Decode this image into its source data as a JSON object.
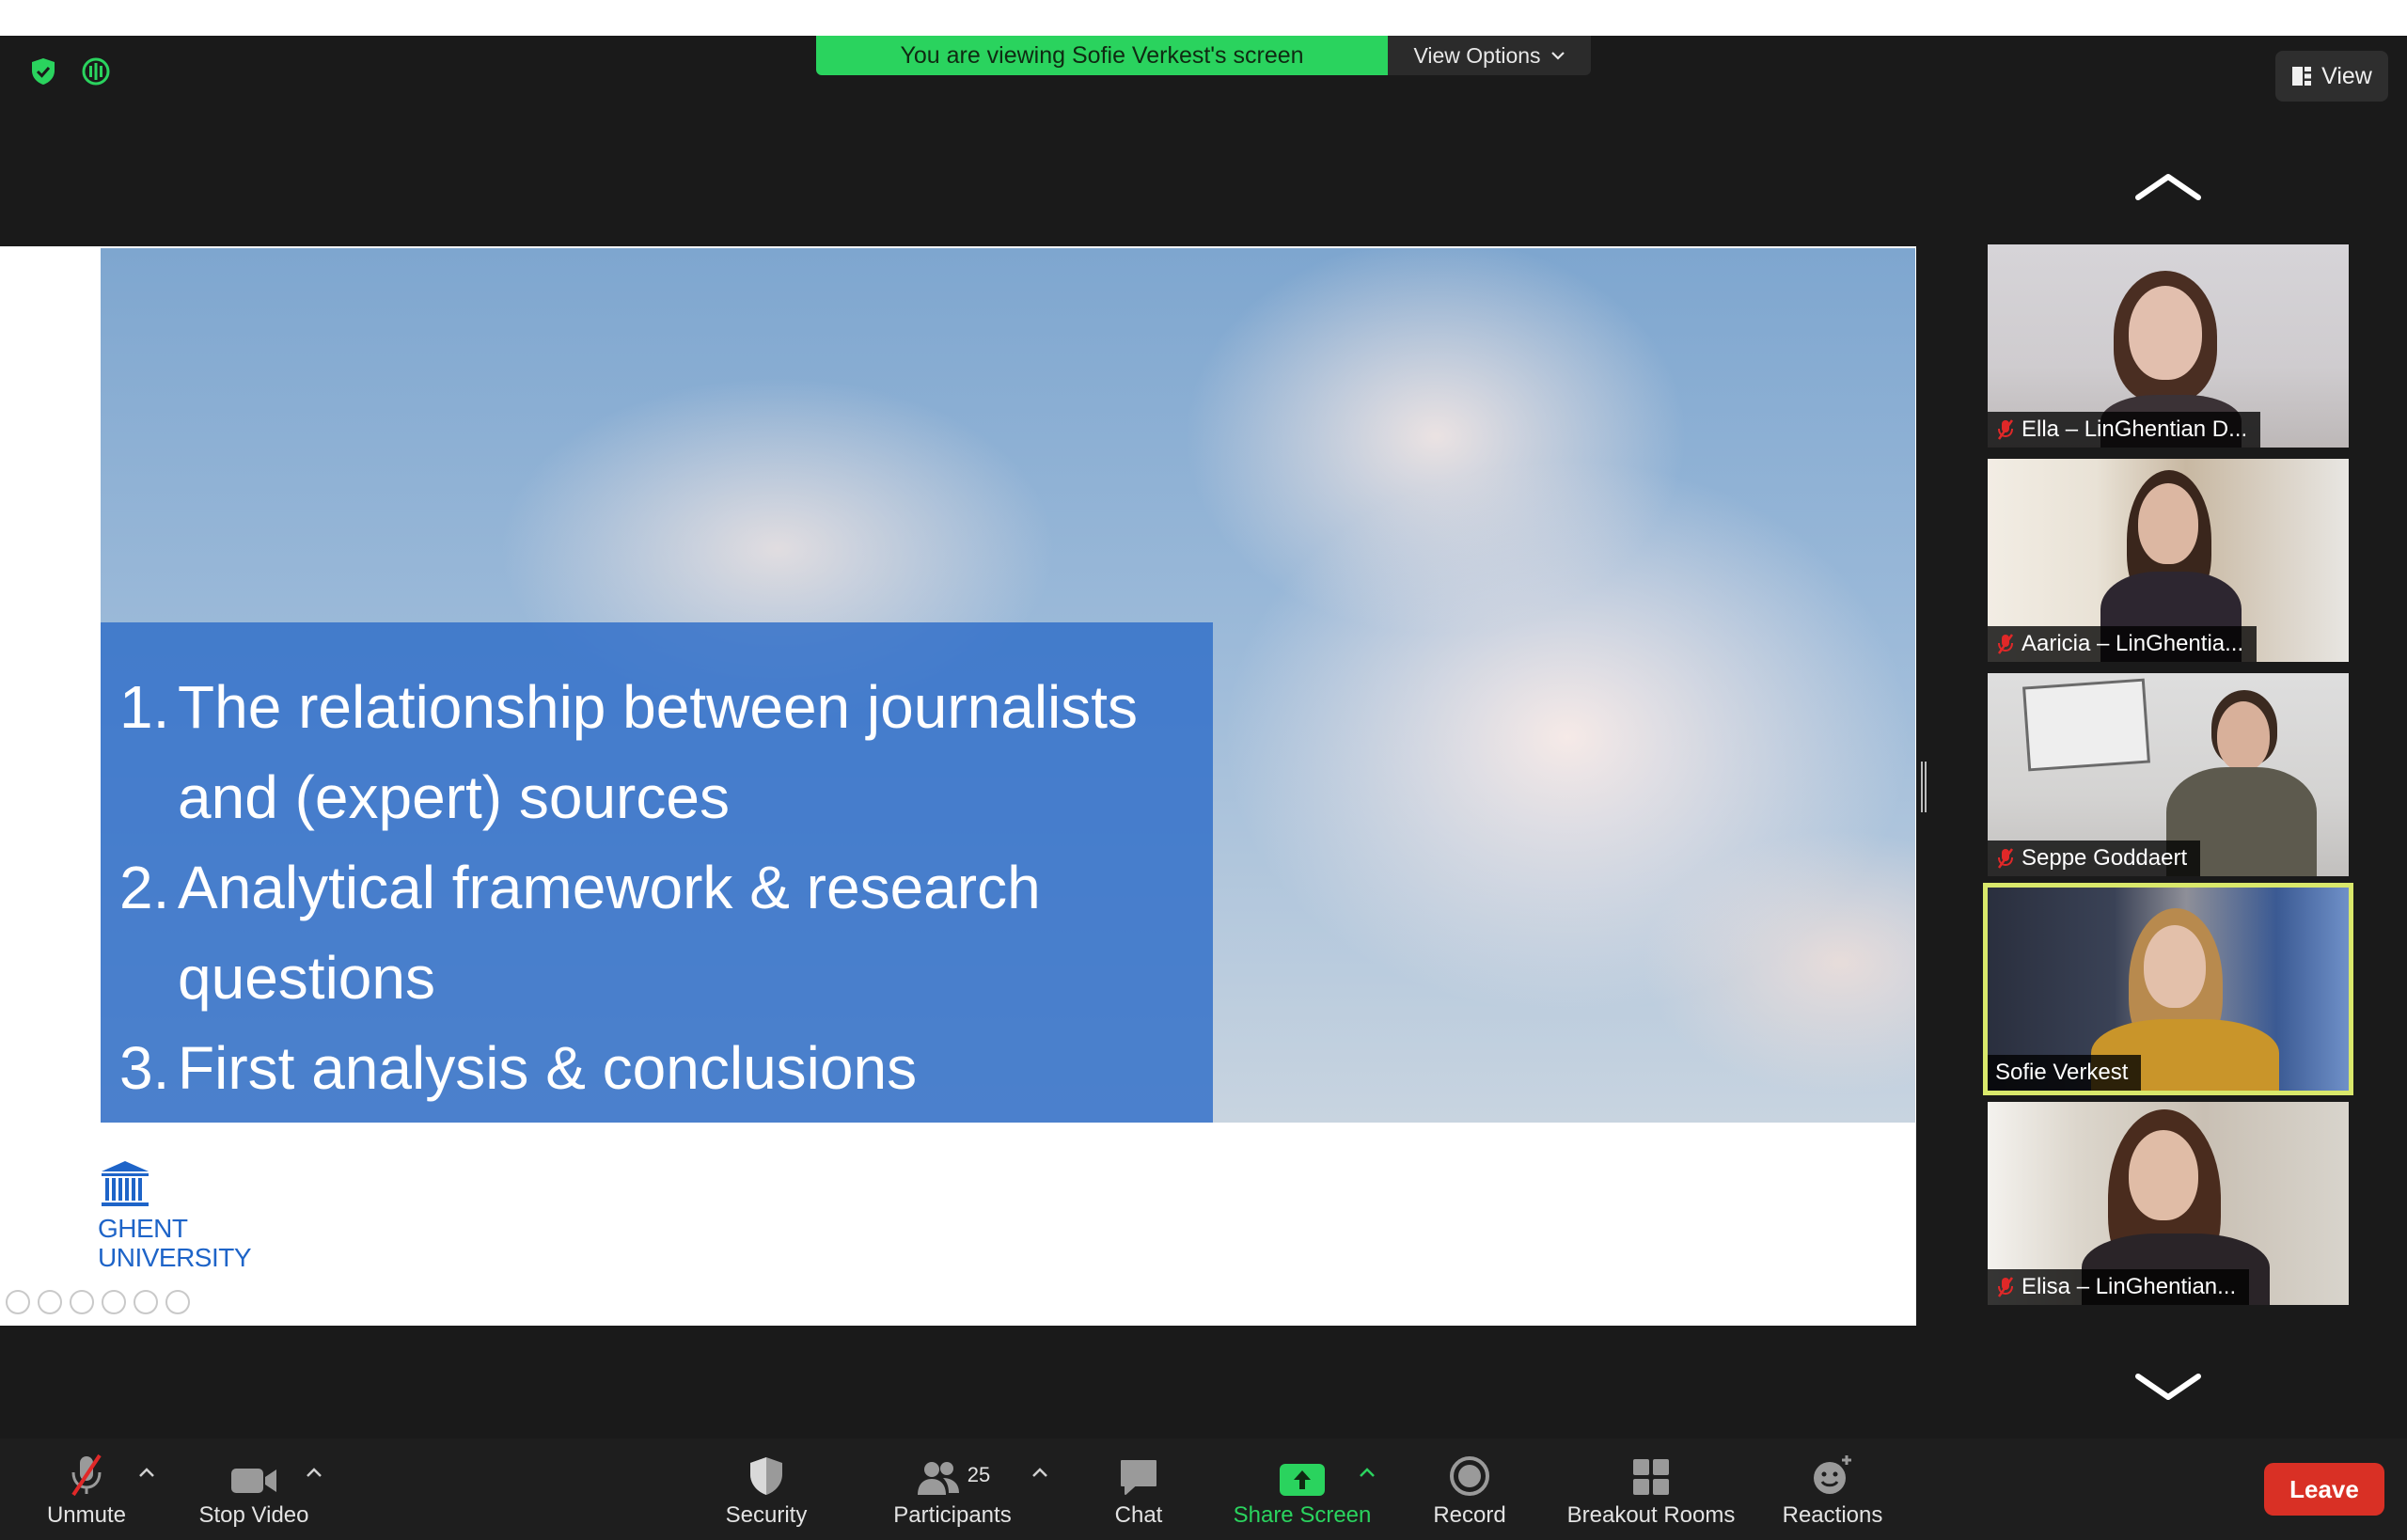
{
  "banner": {
    "message": "You are viewing Sofie Verkest's screen",
    "options_label": "View Options"
  },
  "view_button": {
    "label": "View"
  },
  "status_icons": [
    "shield-check-icon",
    "recording-indicator-icon"
  ],
  "slide": {
    "items": [
      {
        "num": "1.",
        "text": "The relationship between journalists and (expert) sources"
      },
      {
        "num": "2.",
        "text": "Analytical framework & research questions"
      },
      {
        "num": "3.",
        "text": "First analysis & conclusions"
      }
    ],
    "logo": {
      "line1": "GHENT",
      "line2": "UNIVERSITY"
    }
  },
  "gallery": [
    {
      "name": "Ella – LinGhentian D...",
      "muted": true,
      "active": false
    },
    {
      "name": "Aaricia – LinGhentia...",
      "muted": true,
      "active": false
    },
    {
      "name": "Seppe Goddaert",
      "muted": true,
      "active": false
    },
    {
      "name": "Sofie Verkest",
      "muted": false,
      "active": true
    },
    {
      "name": "Elisa – LinGhentian...",
      "muted": true,
      "active": false
    }
  ],
  "toolbar": {
    "unmute": "Unmute",
    "stop_video": "Stop Video",
    "security": "Security",
    "participants": "Participants",
    "participant_count": "25",
    "chat": "Chat",
    "share_screen": "Share Screen",
    "record": "Record",
    "breakout_rooms": "Breakout Rooms",
    "reactions": "Reactions",
    "leave": "Leave"
  },
  "colors": {
    "banner_green": "#2ad35e",
    "share_green": "#2ad35e",
    "leave_red": "#d93025",
    "active_speaker": "#d9e86b",
    "slide_panel_blue": "#306ec8"
  }
}
